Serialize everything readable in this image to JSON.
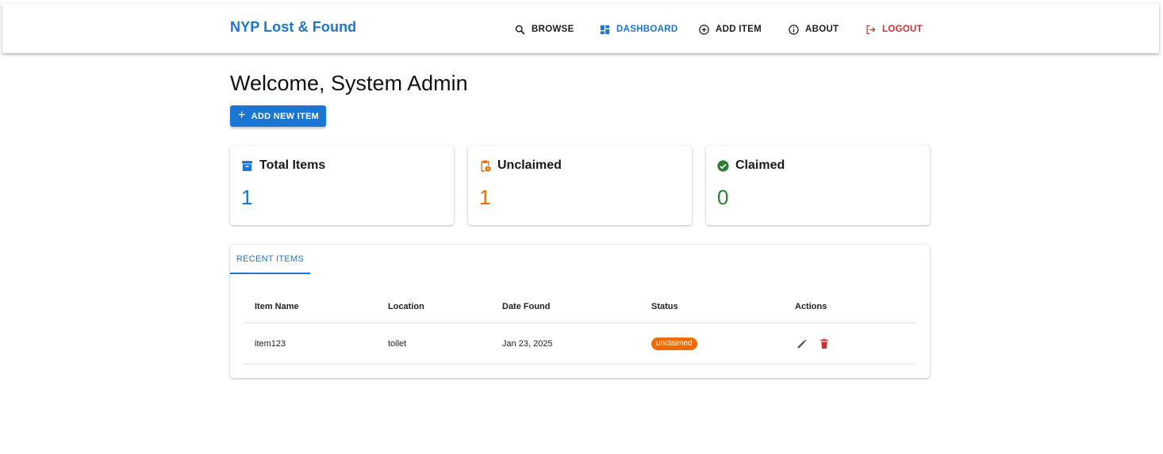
{
  "header": {
    "brand": "NYP Lost & Found",
    "nav": [
      {
        "label": "BROWSE",
        "icon": "search-icon"
      },
      {
        "label": "DASHBOARD",
        "icon": "dashboard-icon",
        "active": true
      },
      {
        "label": "ADD ITEM",
        "icon": "add-circle-icon"
      },
      {
        "label": "ABOUT",
        "icon": "info-icon"
      },
      {
        "label": "LOGOUT",
        "icon": "logout-icon"
      }
    ]
  },
  "main": {
    "welcome": "Welcome, System Admin",
    "add_button_label": "ADD NEW ITEM",
    "add_button_icon": "plus-icon"
  },
  "stats": [
    {
      "label": "Total Items",
      "value": "1",
      "icon": "archive-icon",
      "color": "#1976d2"
    },
    {
      "label": "Unclaimed",
      "value": "1",
      "icon": "clipboard-pending-icon",
      "color": "#ed6c02"
    },
    {
      "label": "Claimed",
      "value": "0",
      "icon": "check-circle-icon",
      "color": "#2e7d32"
    }
  ],
  "recent": {
    "tab_label": "RECENT ITEMS",
    "columns": [
      "Item Name",
      "Location",
      "Date Found",
      "Status",
      "Actions"
    ],
    "rows": [
      {
        "name": "item123",
        "location": "toilet",
        "date": "Jan 23, 2025",
        "status": "unclaimed"
      }
    ]
  },
  "colors": {
    "primary": "#1976d2",
    "danger": "#d32f2f",
    "warning": "#ed6c02",
    "success": "#2e7d32"
  }
}
